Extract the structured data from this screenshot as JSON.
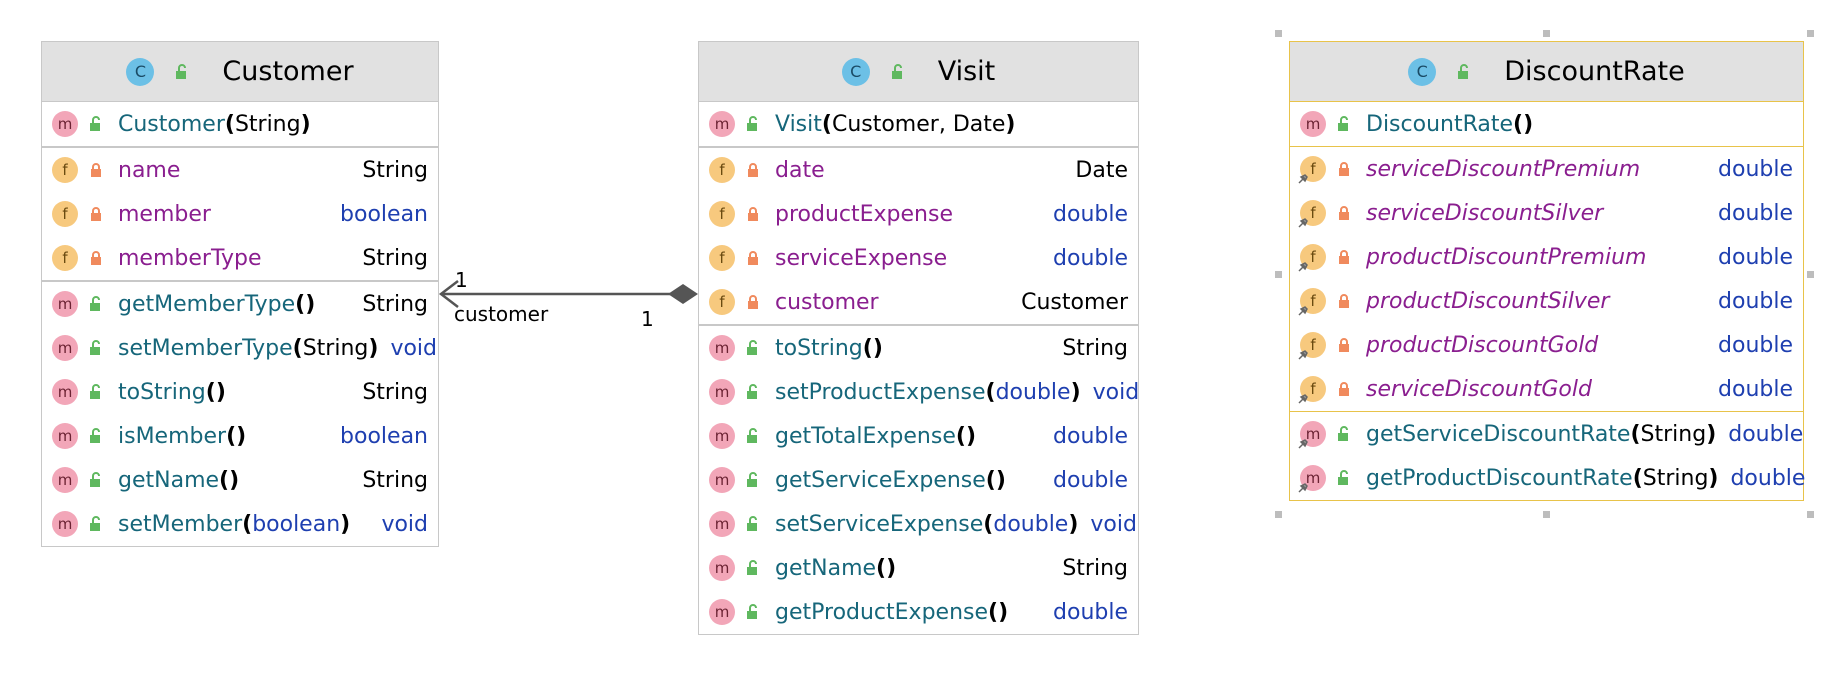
{
  "classes": {
    "customer": {
      "name": "Customer",
      "constructors": [
        {
          "name": "Customer",
          "params": [
            {
              "type": "String",
              "prim": false
            }
          ]
        }
      ],
      "fields": [
        {
          "name": "name",
          "type": "String",
          "prim": false
        },
        {
          "name": "member",
          "type": "boolean",
          "prim": true
        },
        {
          "name": "memberType",
          "type": "String",
          "prim": false
        }
      ],
      "methods": [
        {
          "name": "getMemberType",
          "params": [],
          "ret": "String",
          "prim": false
        },
        {
          "name": "setMemberType",
          "params": [
            {
              "type": "String",
              "prim": false
            }
          ],
          "ret": "void",
          "prim": true
        },
        {
          "name": "toString",
          "params": [],
          "ret": "String",
          "prim": false
        },
        {
          "name": "isMember",
          "params": [],
          "ret": "boolean",
          "prim": true
        },
        {
          "name": "getName",
          "params": [],
          "ret": "String",
          "prim": false
        },
        {
          "name": "setMember",
          "params": [
            {
              "type": "boolean",
              "prim": true
            }
          ],
          "ret": "void",
          "prim": true
        }
      ]
    },
    "visit": {
      "name": "Visit",
      "constructors": [
        {
          "name": "Visit",
          "params": [
            {
              "type": "Customer",
              "prim": false
            },
            {
              "type": "Date",
              "prim": false
            }
          ]
        }
      ],
      "fields": [
        {
          "name": "date",
          "type": "Date",
          "prim": false
        },
        {
          "name": "productExpense",
          "type": "double",
          "prim": true
        },
        {
          "name": "serviceExpense",
          "type": "double",
          "prim": true
        },
        {
          "name": "customer",
          "type": "Customer",
          "prim": false
        }
      ],
      "methods": [
        {
          "name": "toString",
          "params": [],
          "ret": "String",
          "prim": false
        },
        {
          "name": "setProductExpense",
          "params": [
            {
              "type": "double",
              "prim": true
            }
          ],
          "ret": "void",
          "prim": true
        },
        {
          "name": "getTotalExpense",
          "params": [],
          "ret": "double",
          "prim": true
        },
        {
          "name": "getServiceExpense",
          "params": [],
          "ret": "double",
          "prim": true
        },
        {
          "name": "setServiceExpense",
          "params": [
            {
              "type": "double",
              "prim": true
            }
          ],
          "ret": "void",
          "prim": true
        },
        {
          "name": "getName",
          "params": [],
          "ret": "String",
          "prim": false
        },
        {
          "name": "getProductExpense",
          "params": [],
          "ret": "double",
          "prim": true
        }
      ]
    },
    "discount": {
      "name": "DiscountRate",
      "constructors": [
        {
          "name": "DiscountRate",
          "params": []
        }
      ],
      "fields": [
        {
          "name": "serviceDiscountPremium",
          "type": "double",
          "prim": true
        },
        {
          "name": "serviceDiscountSilver",
          "type": "double",
          "prim": true
        },
        {
          "name": "productDiscountPremium",
          "type": "double",
          "prim": true
        },
        {
          "name": "productDiscountSilver",
          "type": "double",
          "prim": true
        },
        {
          "name": "productDiscountGold",
          "type": "double",
          "prim": true
        },
        {
          "name": "serviceDiscountGold",
          "type": "double",
          "prim": true
        }
      ],
      "methods": [
        {
          "name": "getServiceDiscountRate",
          "params": [
            {
              "type": "String",
              "prim": false
            }
          ],
          "ret": "double",
          "prim": true
        },
        {
          "name": "getProductDiscountRate",
          "params": [
            {
              "type": "String",
              "prim": false
            }
          ],
          "ret": "double",
          "prim": true
        }
      ]
    }
  },
  "association": {
    "role": "customer",
    "source_multiplicity": "1",
    "target_multiplicity": "1"
  },
  "icons": {
    "class": "C",
    "method": "m",
    "field": "f"
  },
  "colors": {
    "header_bg": "#e1e1e1",
    "border": "#c8c8c8",
    "selection": "#e8c34a",
    "method_name": "#16667a",
    "field_name": "#8a1e8f",
    "primitive_type": "#1e3fb0"
  }
}
